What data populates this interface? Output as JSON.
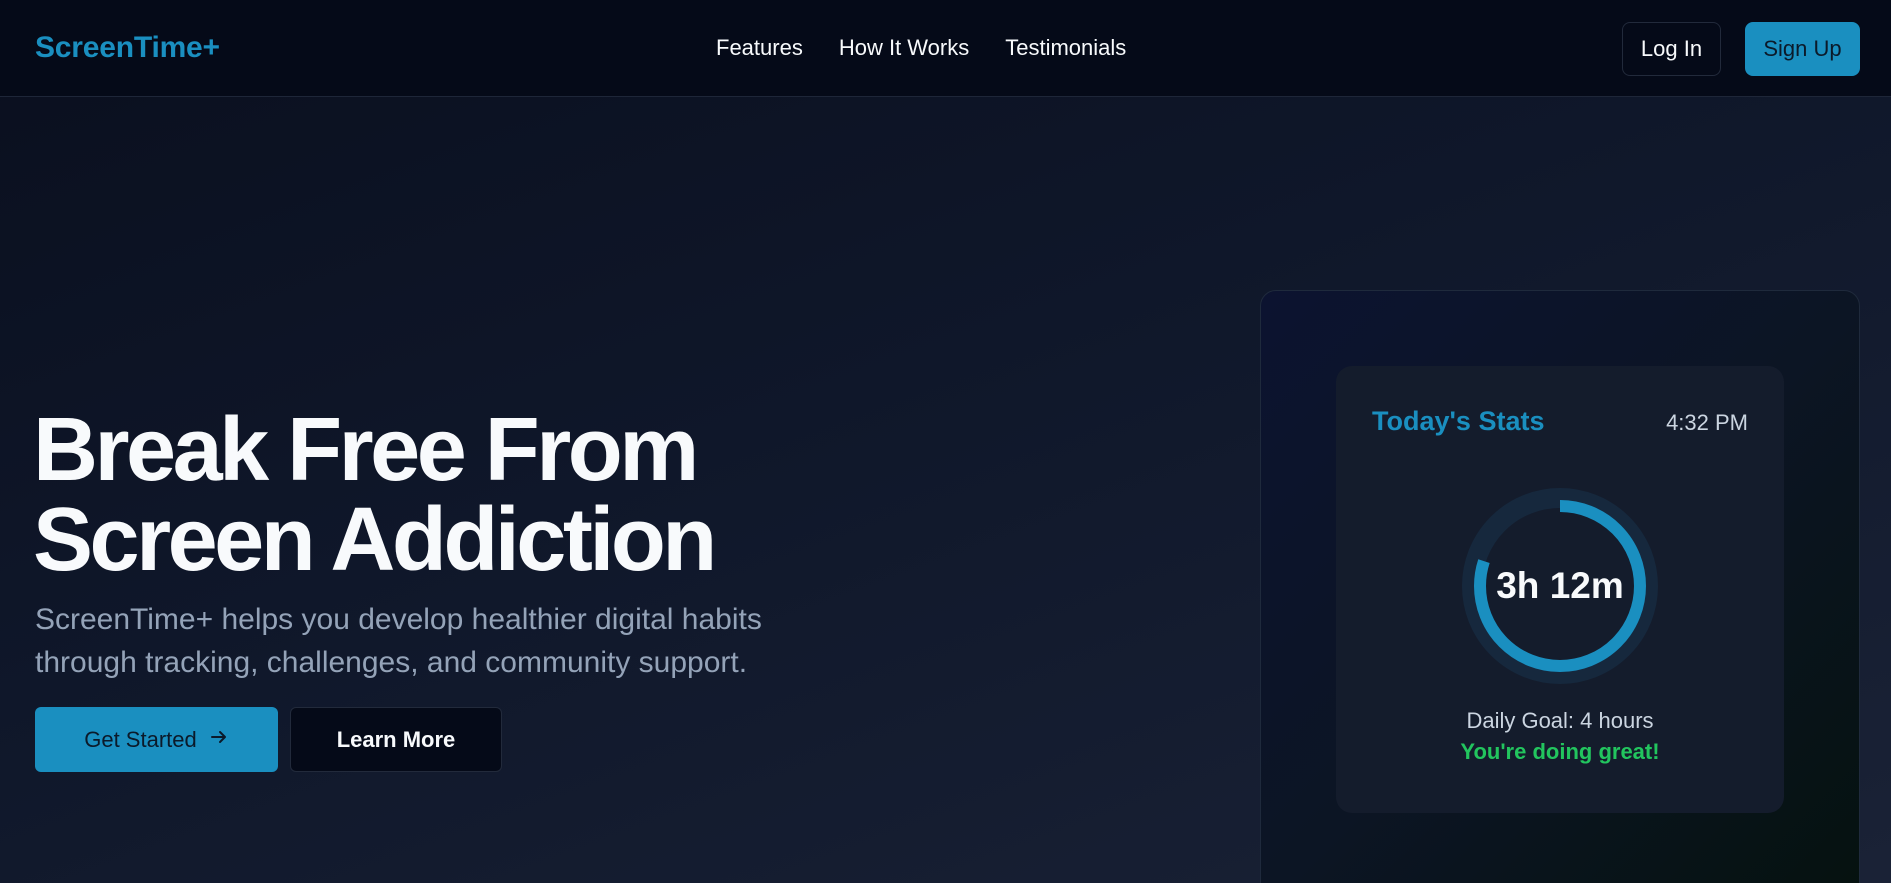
{
  "header": {
    "logo": "ScreenTime+",
    "nav": [
      "Features",
      "How It Works",
      "Testimonials"
    ],
    "login_label": "Log In",
    "signup_label": "Sign Up"
  },
  "hero": {
    "title_line1": "Break Free From",
    "title_line2": "Screen Addiction",
    "subtitle": "ScreenTime+ helps you develop healthier digital habits through tracking, challenges, and community support.",
    "get_started_label": "Get Started",
    "learn_more_label": "Learn More"
  },
  "stats_card": {
    "title": "Today's Stats",
    "time": "4:32 PM",
    "usage": "3h 12m",
    "goal_text": "Daily Goal: 4 hours",
    "status_text": "You're doing great!",
    "progress_fraction": 0.8
  },
  "colors": {
    "accent": "#1a8fc0",
    "success": "#22c55e",
    "background": "#0f172a"
  },
  "icons": {
    "get_started_icon": "arrow-right-icon"
  }
}
